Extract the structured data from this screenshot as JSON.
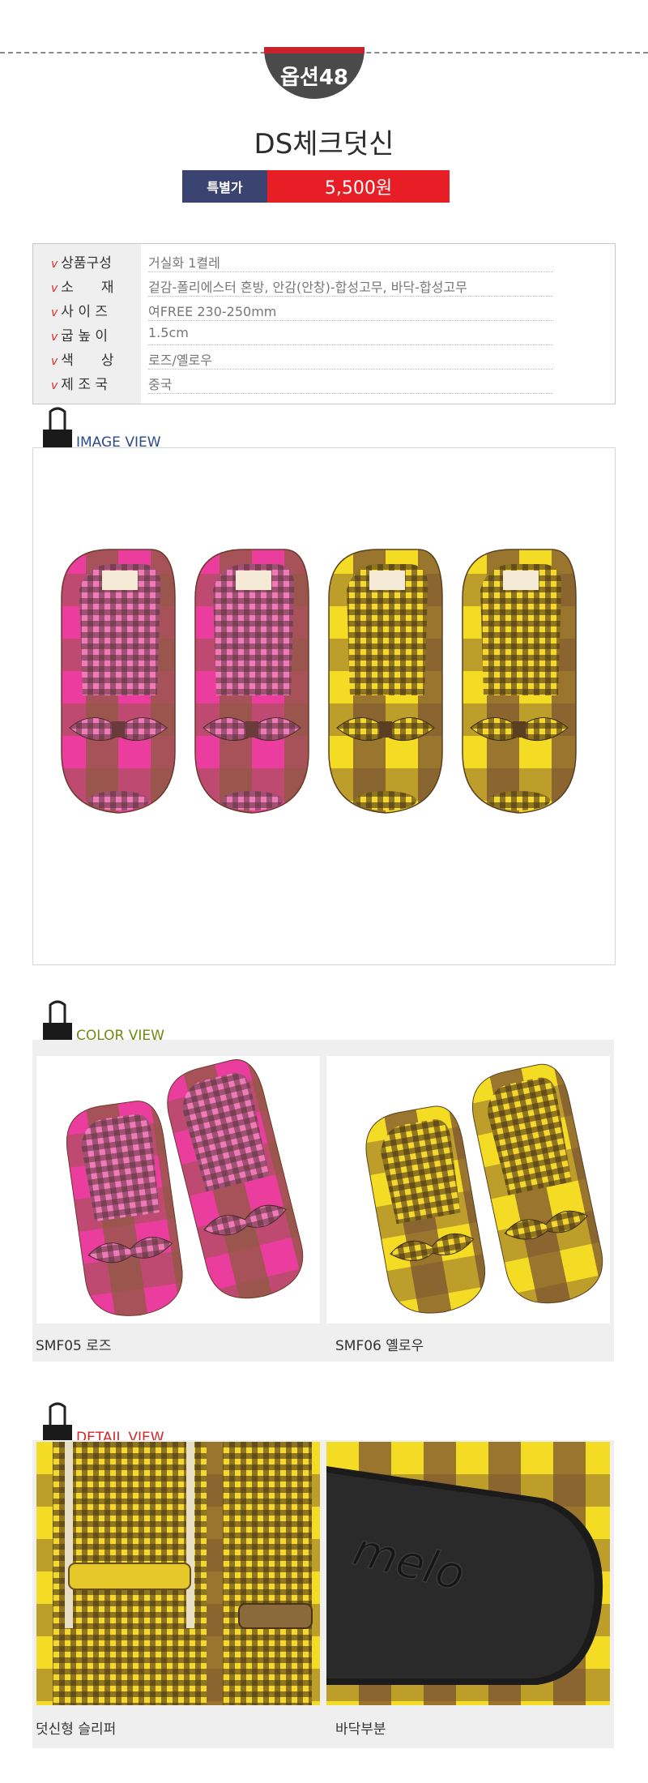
{
  "option_badge": "옵션48",
  "product_title": "DS체크덧신",
  "price": {
    "label": "특별가",
    "value": "5,500원"
  },
  "specs": [
    {
      "key": "상품구성",
      "value": "거실화 1켤레"
    },
    {
      "key": "소　　재",
      "value": "겉감-폴리에스터 혼방, 안감(안창)-합성고무, 바닥-합성고무"
    },
    {
      "key": "사 이 즈",
      "value": "여FREE 230-250mm"
    },
    {
      "key": "굽 높 이",
      "value": "1.5cm"
    },
    {
      "key": "색　　상",
      "value": "로즈/옐로우"
    },
    {
      "key": "제 조 국",
      "value": "중국"
    }
  ],
  "sections": {
    "image_view": {
      "label": "IMAGE VIEW",
      "color": "#2d4a8a"
    },
    "color_view": {
      "label": "COLOR VIEW",
      "color": "#6f8a12"
    },
    "detail_view": {
      "label": "DETAIL VIEW",
      "color": "#d7262a"
    }
  },
  "color_items": [
    {
      "caption": "SMF05 로즈"
    },
    {
      "caption": "SMF06 옐로우"
    }
  ],
  "detail_items": [
    {
      "caption": "덧신형 슬리퍼"
    },
    {
      "caption": "바닥부분"
    }
  ],
  "sole_brand_text": "melo",
  "colors": {
    "rose": "#e8399a",
    "yellow": "#f2d21f",
    "brown": "#7a4f2a",
    "price_red": "#e81e26",
    "navy": "#3b4470"
  }
}
